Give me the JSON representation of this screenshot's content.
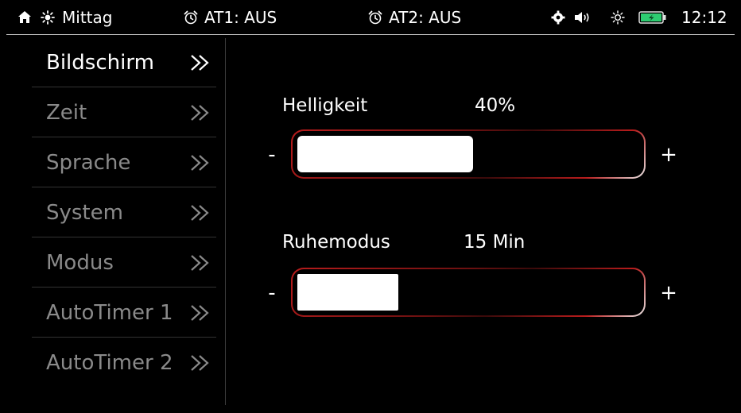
{
  "status_bar": {
    "mode_label": "Mittag",
    "timer1": "AT1: AUS",
    "timer2": "AT2: AUS",
    "time": "12:12",
    "icons": [
      "home-icon",
      "sun-icon",
      "alarm-clock-icon",
      "alarm-clock-icon",
      "settings-cog-icon",
      "speaker-icon",
      "brightness-icon",
      "battery-charging-icon"
    ],
    "battery_color": "#2ecc71"
  },
  "sidebar": {
    "items": [
      {
        "label": "Bildschirm",
        "active": true
      },
      {
        "label": "Zeit",
        "active": false
      },
      {
        "label": "Sprache",
        "active": false
      },
      {
        "label": "System",
        "active": false
      },
      {
        "label": "Modus",
        "active": false
      },
      {
        "label": "AutoTimer 1",
        "active": false
      },
      {
        "label": "AutoTimer 2",
        "active": false
      }
    ]
  },
  "settings": {
    "brightness": {
      "label": "Helligkeit",
      "value": "40%",
      "level": 0.4,
      "minus": "-",
      "plus": "+"
    },
    "sleep": {
      "label": "Ruhemodus",
      "value": "15 Min",
      "level": 0.25,
      "minus": "-",
      "plus": "+"
    }
  },
  "colors": {
    "accent_border": "#b91c1c",
    "background": "#000000",
    "inactive_text": "#8a8a8a"
  }
}
